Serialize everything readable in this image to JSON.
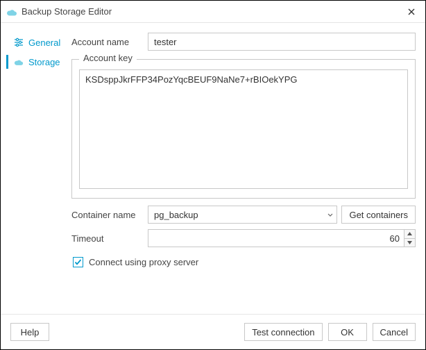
{
  "window": {
    "title": "Backup Storage Editor"
  },
  "sidebar": {
    "items": [
      {
        "label": "General"
      },
      {
        "label": "Storage"
      }
    ]
  },
  "form": {
    "account_name_label": "Account name",
    "account_name_value": "tester",
    "account_key_label": "Account key",
    "account_key_value": "KSDsppJkrFFP34PozYqcBEUF9NaNe7+rBIOekYPG",
    "container_label": "Container name",
    "container_value": "pg_backup",
    "get_containers_label": "Get containers",
    "timeout_label": "Timeout",
    "timeout_value": "60",
    "proxy_label": "Connect using proxy server",
    "proxy_checked": true
  },
  "footer": {
    "help": "Help",
    "test": "Test connection",
    "ok": "OK",
    "cancel": "Cancel"
  }
}
